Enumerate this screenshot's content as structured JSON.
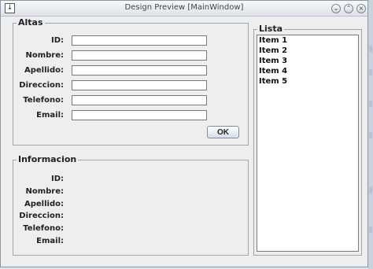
{
  "window": {
    "title": "Design Preview [MainWindow]"
  },
  "altas": {
    "title": "Altas",
    "labels": [
      "ID:",
      "Nombre:",
      "Apellido:",
      "Direccion:",
      "Telefono:",
      "Email:"
    ],
    "values": [
      "",
      "",
      "",
      "",
      "",
      ""
    ],
    "ok_label": "OK"
  },
  "informacion": {
    "title": "Informacion",
    "labels": [
      "ID:",
      "Nombre:",
      "Apellido:",
      "Direccion:",
      "Telefono:",
      "Email:"
    ]
  },
  "lista": {
    "title": "Lista",
    "items": [
      "Item 1",
      "Item 2",
      "Item 3",
      "Item 4",
      "Item 5"
    ]
  }
}
